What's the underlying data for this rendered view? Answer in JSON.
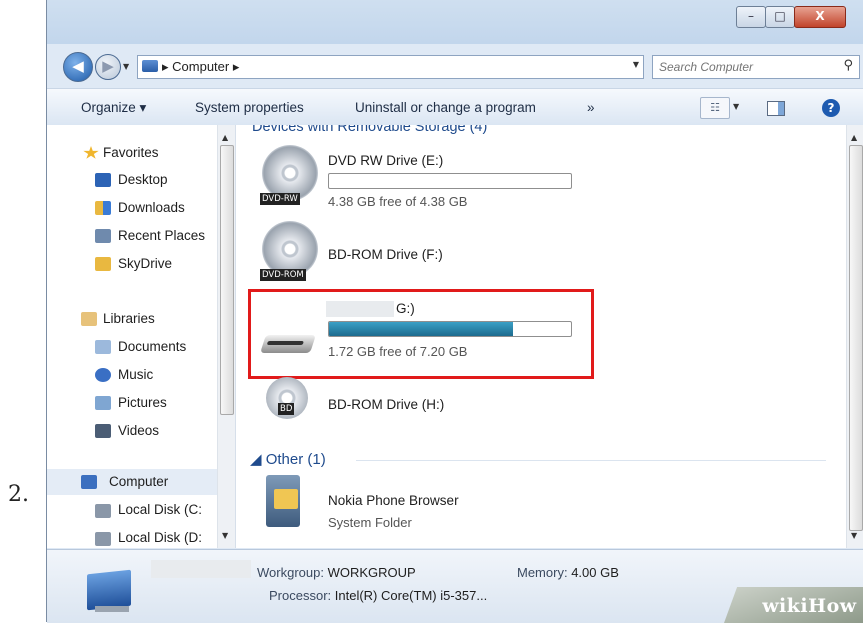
{
  "step_number": "2.",
  "window": {
    "caption": {
      "minimize": "–",
      "maximize": "□",
      "close": "X"
    }
  },
  "address_bar": {
    "breadcrumb": "▸ Computer ▸",
    "search_placeholder": "Search Computer"
  },
  "toolbar": {
    "organize": "Organize ▾",
    "system_properties": "System properties",
    "uninstall": "Uninstall or change a program",
    "more": "»",
    "help": "?"
  },
  "nav": {
    "favorites": {
      "header": "Favorites",
      "items": [
        "Desktop",
        "Downloads",
        "Recent Places",
        "SkyDrive"
      ]
    },
    "libraries": {
      "header": "Libraries",
      "items": [
        "Documents",
        "Music",
        "Pictures",
        "Videos"
      ]
    },
    "computer": {
      "header": "Computer",
      "items": [
        "Local Disk (C:",
        "Local Disk (D:"
      ]
    }
  },
  "content": {
    "removable_group_header_partial": "Devices with Removable Storage (4)",
    "drives": [
      {
        "name": "DVD RW Drive (E:)",
        "badge": "DVD-RW",
        "free_text": "4.38 GB free of 4.38 GB",
        "used_fraction": 0.0
      },
      {
        "name": "BD-ROM Drive (F:)",
        "badge": "DVD-ROM"
      },
      {
        "name": "G:)",
        "free_text": "1.72 GB free of 7.20 GB",
        "used_fraction": 0.76
      },
      {
        "name": "BD-ROM Drive (H:)",
        "badge": "BD"
      }
    ],
    "other_group": {
      "header": "◢ Other (1)",
      "items": [
        {
          "name": "Nokia Phone Browser",
          "type": "System Folder"
        }
      ]
    }
  },
  "details": {
    "workgroup_label": "Workgroup:",
    "workgroup_value": "WORKGROUP",
    "memory_label": "Memory:",
    "memory_value": "4.00 GB",
    "processor_label": "Processor:",
    "processor_value": "Intel(R) Core(TM) i5-357..."
  },
  "watermark": "wikiHow",
  "colors": {
    "highlight": "#e11a1a",
    "accent": "#1f4b8d",
    "bar_fill": "#2486ad"
  }
}
